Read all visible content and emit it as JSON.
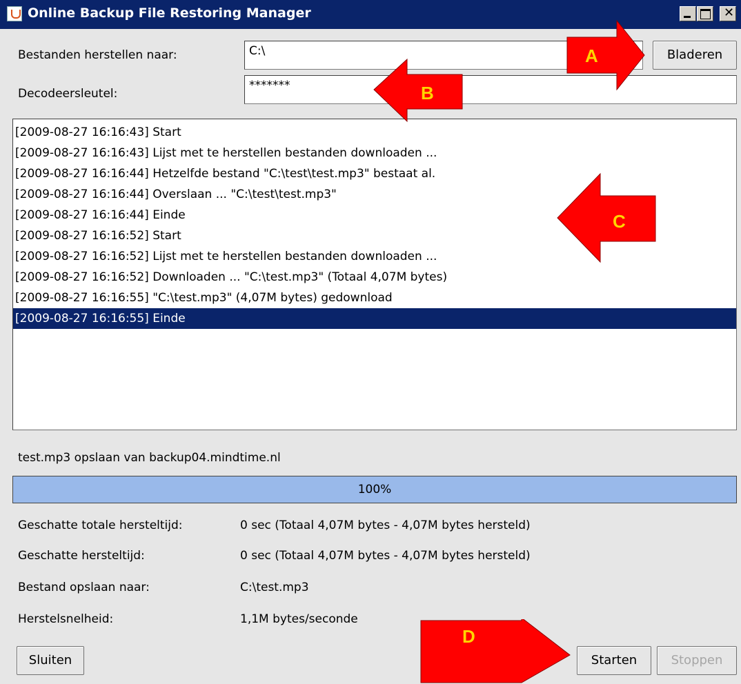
{
  "window": {
    "title": "Online Backup File Restoring Manager"
  },
  "form": {
    "restore_to_label": "Bestanden herstellen naar:",
    "restore_to_value": "C:\\",
    "browse_label": "Bladeren",
    "key_label": "Decodeersleutel:",
    "key_value": "*******"
  },
  "log": {
    "lines": [
      "[2009-08-27 16:16:43] Start",
      "[2009-08-27 16:16:43] Lijst met te herstellen bestanden downloaden ...",
      "[2009-08-27 16:16:44] Hetzelfde bestand \"C:\\test\\test.mp3\" bestaat al.",
      "[2009-08-27 16:16:44] Overslaan ... \"C:\\test\\test.mp3\"",
      "[2009-08-27 16:16:44] Einde",
      "[2009-08-27 16:16:52] Start",
      "[2009-08-27 16:16:52] Lijst met te herstellen bestanden downloaden ...",
      "[2009-08-27 16:16:52] Downloaden ... \"C:\\test.mp3\" (Totaal 4,07M bytes)",
      "[2009-08-27 16:16:55] \"C:\\test.mp3\" (4,07M bytes) gedownload",
      "[2009-08-27 16:16:55] Einde"
    ],
    "selected_index": 9
  },
  "status": {
    "current_file": "test.mp3 opslaan van backup04.mindtime.nl",
    "progress_percent": 100,
    "progress_label": "100%",
    "total_time_label": "Geschatte totale hersteltijd:",
    "total_time_value": "0 sec (Totaal 4,07M bytes - 4,07M bytes hersteld)",
    "time_label": "Geschatte hersteltijd:",
    "time_value": "0 sec (Totaal 4,07M bytes - 4,07M bytes hersteld)",
    "save_to_label": "Bestand opslaan naar:",
    "save_to_value": "C:\\test.mp3",
    "speed_label": "Herstelsnelheid:",
    "speed_value": "1,1M bytes/seconde"
  },
  "buttons": {
    "close": "Sluiten",
    "start": "Starten",
    "stop": "Stoppen"
  },
  "annotations": {
    "a": "A",
    "b": "B",
    "c": "C",
    "d": "D"
  },
  "colors": {
    "titlebar": "#0a246a",
    "selection": "#0a246a",
    "progress": "#99b9ea",
    "arrow": "#ff0000",
    "arrow_letter": "#ffd400"
  }
}
